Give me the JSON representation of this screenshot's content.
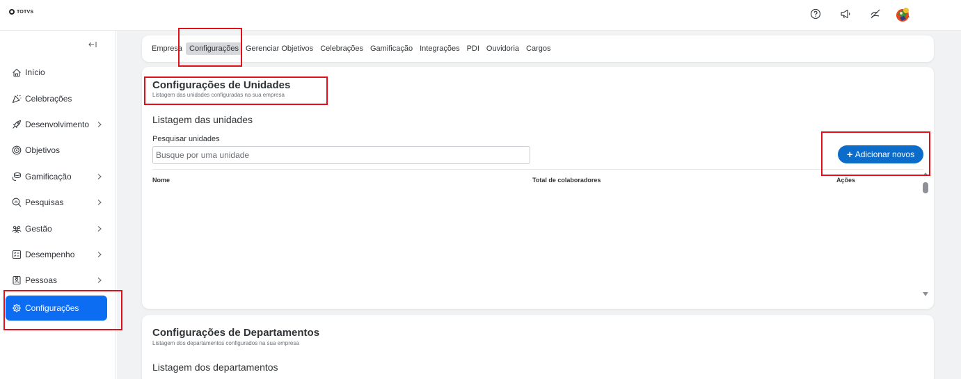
{
  "brand": {
    "logo_text": "TOTVS"
  },
  "topbar": {
    "icons": [
      "help-icon",
      "megaphone-icon",
      "hand-slash-icon",
      "bell-icon",
      "avatar"
    ]
  },
  "sidebar": {
    "items": [
      {
        "label": "Início",
        "icon": "home-icon",
        "has_chevron": false
      },
      {
        "label": "Celebrações",
        "icon": "celebration-icon",
        "has_chevron": false
      },
      {
        "label": "Desenvolvimento",
        "icon": "rocket-icon",
        "has_chevron": true
      },
      {
        "label": "Objetivos",
        "icon": "target-icon",
        "has_chevron": false
      },
      {
        "label": "Gamificação",
        "icon": "coins-icon",
        "has_chevron": true
      },
      {
        "label": "Pesquisas",
        "icon": "survey-icon",
        "has_chevron": true
      },
      {
        "label": "Gestão",
        "icon": "people-icon",
        "has_chevron": true
      },
      {
        "label": "Desempenho",
        "icon": "checklist-icon",
        "has_chevron": true
      },
      {
        "label": "Pessoas",
        "icon": "badge-icon",
        "has_chevron": true
      },
      {
        "label": "Configurações",
        "icon": "gear-icon",
        "has_chevron": false,
        "active": true
      }
    ]
  },
  "tabs": [
    {
      "label": "Empresa"
    },
    {
      "label": "Configurações",
      "active": true
    },
    {
      "label": "Gerenciar Objetivos"
    },
    {
      "label": "Celebrações"
    },
    {
      "label": "Gamificação"
    },
    {
      "label": "Integrações"
    },
    {
      "label": "PDI"
    },
    {
      "label": "Ouvidoria"
    },
    {
      "label": "Cargos"
    }
  ],
  "units": {
    "title": "Configurações de Unidades",
    "subtitle": "Listagem das unidades configuradas na sua empresa",
    "list_title": "Listagem das unidades",
    "search_label": "Pesquisar unidades",
    "search_placeholder": "Busque por uma unidade",
    "search_value": "",
    "add_button": "Adicionar novos",
    "columns": [
      "Nome",
      "Total de colaboradores",
      "Ações"
    ]
  },
  "departments": {
    "title": "Configurações de Departamentos",
    "subtitle": "Listagem dos departamentos configurados na sua empresa",
    "list_title": "Listagem dos departamentos"
  },
  "colors": {
    "accent": "#0c6cf2",
    "button": "#0c6cc9",
    "highlight_box": "#e0101a"
  }
}
